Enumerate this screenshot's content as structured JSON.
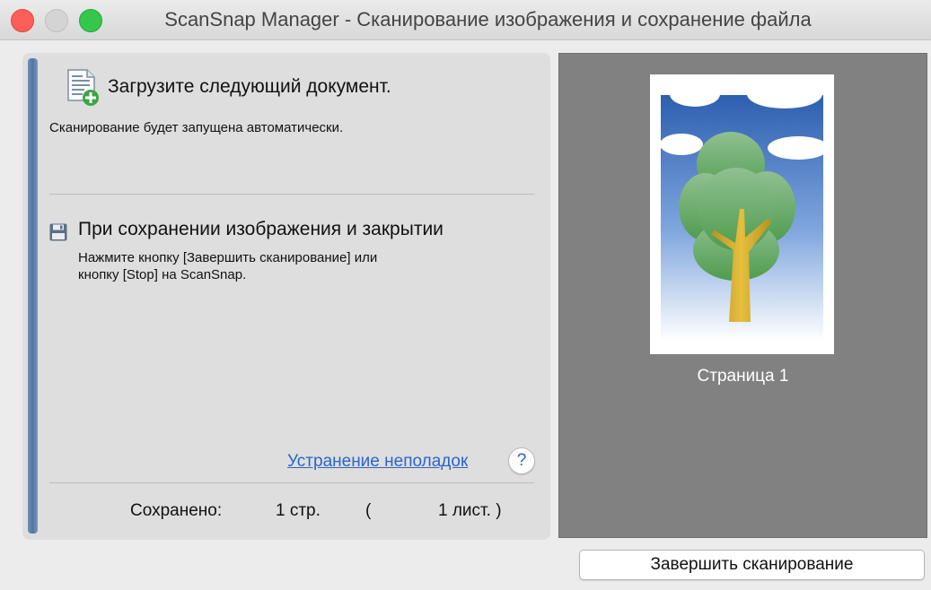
{
  "window": {
    "title": "ScanSnap Manager - Сканирование изображения и сохранение файла"
  },
  "status": {
    "load_next": "Загрузите следующий документ.",
    "auto_note": "Сканирование будет запущена автоматически."
  },
  "save_section": {
    "heading": "При сохранении изображения и закрытии",
    "hint_line1": "Нажмите кнопку [Завершить сканирование] или",
    "hint_line2": "кнопку [Stop] на ScanSnap."
  },
  "troubleshooting": {
    "link_label": "Устранение неполадок",
    "help_label": "?"
  },
  "saved": {
    "label": "Сохранено:",
    "pages": "1 стр.",
    "open_paren": "(",
    "sheets": "1 лист. )"
  },
  "preview": {
    "page_caption": "Страница 1"
  },
  "actions": {
    "finish_label": "Завершить сканирование"
  }
}
